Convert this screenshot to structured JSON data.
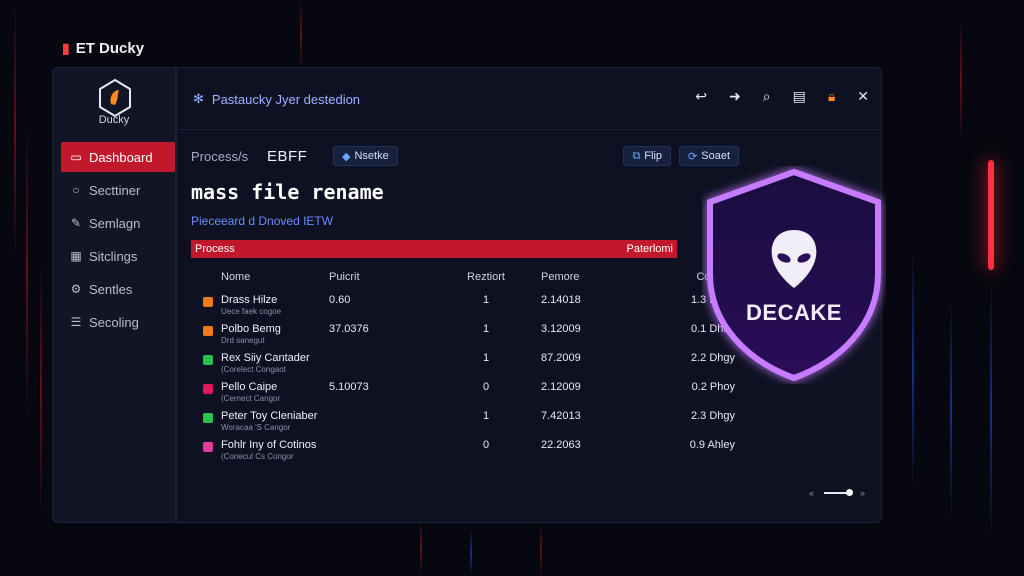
{
  "app": {
    "name": "ET Ducky",
    "logo_text": "Ducky"
  },
  "sidebar": {
    "items": [
      {
        "label": "Dashboard",
        "icon": "dashboard-icon",
        "active": true
      },
      {
        "label": "Secttiner",
        "icon": "search-icon",
        "active": false
      },
      {
        "label": "Semlagn",
        "icon": "edit-icon",
        "active": false
      },
      {
        "label": "Sitclings",
        "icon": "grid-icon",
        "active": false
      },
      {
        "label": "Sentles",
        "icon": "settings-icon",
        "active": false
      },
      {
        "label": "Secoling",
        "icon": "list-icon",
        "active": false
      }
    ]
  },
  "topbar": {
    "title": "Pastaucky Jyer destedion",
    "icons": [
      "back-icon",
      "forward-icon",
      "search-icon",
      "document-icon",
      "lock-icon",
      "close-icon"
    ]
  },
  "process": {
    "label": "Process/s",
    "value": "EBFF",
    "chip": "Nsetke",
    "btn_flip": "Flip",
    "btn_socket": "Soaet"
  },
  "heading": "mass file rename",
  "subheading": "Pieceeard d Dnoved IETW",
  "table": {
    "bar_left": "Process",
    "bar_right": "Paterlomi",
    "columns": [
      "Nome",
      "Puicrit",
      "Reztiort",
      "Pemore",
      "Contant"
    ],
    "rows": [
      {
        "color": "#f07a1a",
        "name": "Drass Hilze",
        "sub": "Uece faek cogoe",
        "prio": "0.60",
        "red": "1",
        "per": "2.14018",
        "con": "1.3 Dayg"
      },
      {
        "color": "#f07a1a",
        "name": "Polbo Bemg",
        "sub": "Drd sanegut",
        "prio": "37.0376",
        "red": "1",
        "per": "3.12009",
        "con": "0.1 Dhqy"
      },
      {
        "color": "#28c24a",
        "name": "Rex Siiy Cantader",
        "sub": "(Corelect Congaot",
        "prio": "",
        "red": "1",
        "per": "87.2009",
        "con": "2.2 Dhgy"
      },
      {
        "color": "#e0185a",
        "name": "Pello Caipe",
        "sub": "(Cernect Cangor",
        "prio": "5.10073",
        "red": "0",
        "per": "2.12009",
        "con": "0.2 Phoy"
      },
      {
        "color": "#28c24a",
        "name": "Peter Toy Cleniaber",
        "sub": "Woracaa 'S Cangor",
        "prio": "",
        "red": "1",
        "per": "7.42013",
        "con": "2.3 Dhgy"
      },
      {
        "color": "#e03c9a",
        "name": "Fohlr Iny of Cotinos",
        "sub": "(Conecul Cs Congor",
        "prio": "",
        "red": "0",
        "per": "22.2063",
        "con": "0.9 Ahley"
      }
    ]
  },
  "shield": {
    "label": "DECAKE"
  },
  "colors": {
    "accent_red": "#c2182c",
    "accent_blue": "#6c8cff",
    "shield_glow": "#b266ff"
  }
}
